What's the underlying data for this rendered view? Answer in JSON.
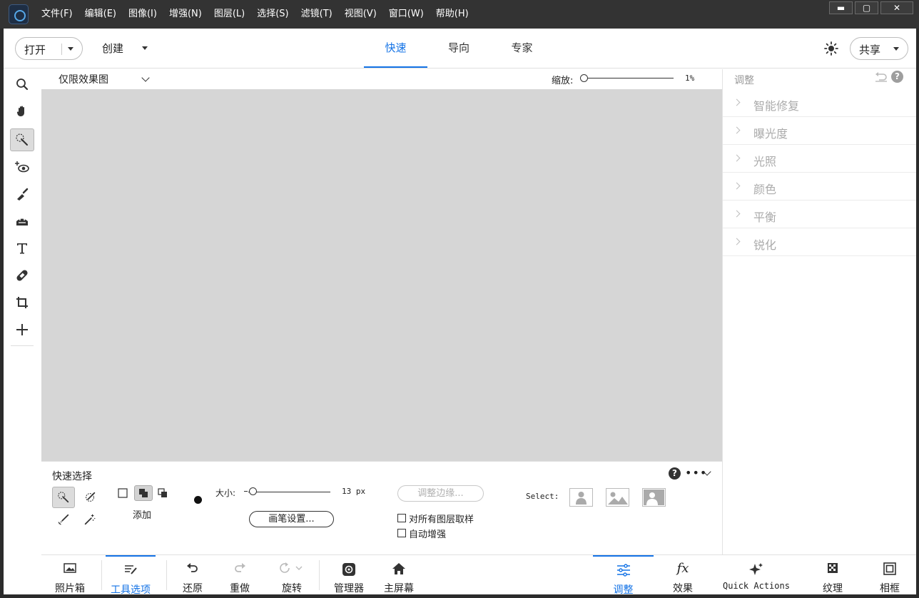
{
  "menu": [
    "文件(F)",
    "编辑(E)",
    "图像(I)",
    "增强(N)",
    "图层(L)",
    "选择(S)",
    "滤镜(T)",
    "视图(V)",
    "窗口(W)",
    "帮助(H)"
  ],
  "window_controls": {
    "minimize": "▬",
    "maximize": "▢",
    "close": "✕"
  },
  "topbar": {
    "open_label": "打开",
    "create_label": "创建",
    "modes": [
      "快速",
      "导向",
      "专家"
    ],
    "active_mode": "快速",
    "share_label": "共享"
  },
  "left_tools": [
    "zoom-icon",
    "hand-icon",
    "quick-selection-icon",
    "red-eye-icon",
    "whiten-teeth-icon",
    "straighten-icon",
    "text-icon",
    "spot-healing-icon",
    "crop-icon",
    "move-icon"
  ],
  "viewbar": {
    "view_mode": "仅限效果图",
    "zoom_label": "缩放:",
    "zoom_value": "1%"
  },
  "adjust_panel": {
    "title": "调整",
    "items": [
      "智能修复",
      "曝光度",
      "光照",
      "颜色",
      "平衡",
      "锐化"
    ]
  },
  "tool_options": {
    "title": "快速选择",
    "add_label": "添加",
    "size_label": "大小:",
    "size_value": "13 px",
    "brush_settings": "画笔设置...",
    "refine_edge": "调整边缘...",
    "sample_all_layers": "对所有图层取样",
    "auto_enhance": "自动增强",
    "select_label": "Select:",
    "help": "?",
    "more": "•••"
  },
  "bottom_bar": {
    "photo_bin": "照片箱",
    "tool_options": "工具选项",
    "undo": "还原",
    "redo": "重做",
    "rotate": "旋转",
    "organizer": "管理器",
    "home_screen": "主屏幕",
    "adjustments": "调整",
    "effects": "效果",
    "quick_actions": "Quick Actions",
    "textures": "纹理",
    "frames": "相框"
  },
  "colors": {
    "accent": "#1473e6",
    "canvas": "#d6d6d6",
    "titlebar": "#333333"
  }
}
